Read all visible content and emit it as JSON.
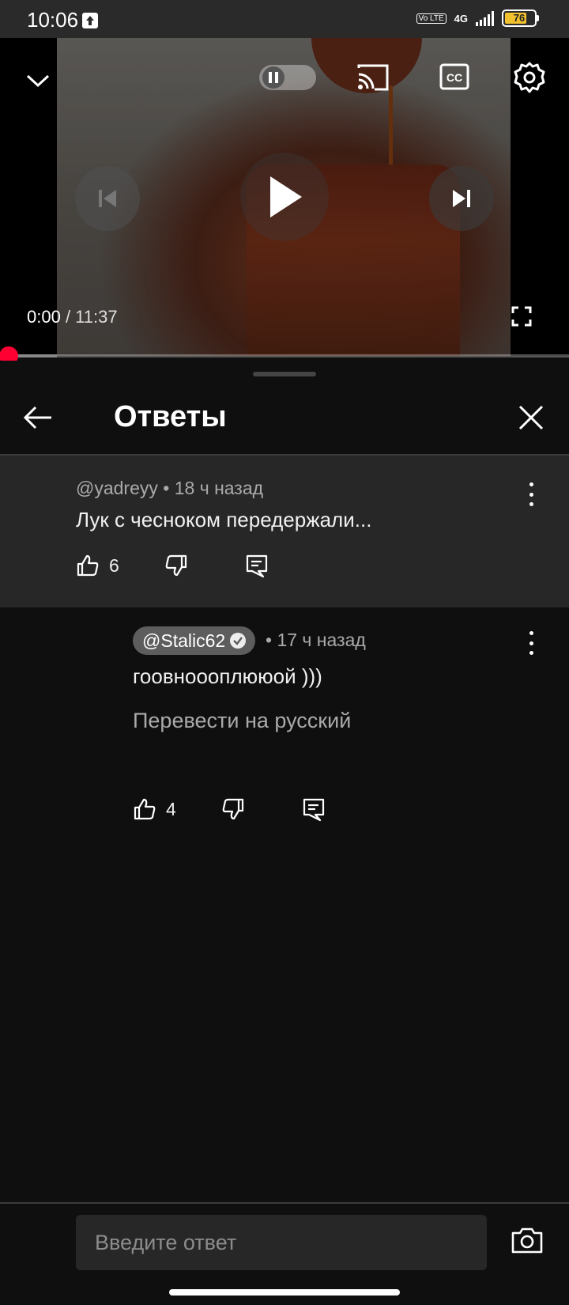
{
  "status_bar": {
    "time": "10:06",
    "volte": "Vo LTE",
    "network": "4G",
    "battery": "76",
    "battery_color": "#f2c12e"
  },
  "player": {
    "current_time": "0:00",
    "separator": " / ",
    "duration": "11:37",
    "progress_color": "#ff0033",
    "icons": [
      "chevron-down-icon",
      "pause-icon",
      "cast-icon",
      "captions-icon",
      "settings-icon",
      "previous-icon",
      "play-icon",
      "next-icon",
      "fullscreen-icon"
    ]
  },
  "panel": {
    "title": "Ответы"
  },
  "parent_comment": {
    "author": "@yadreyy",
    "time": "• 18 ч назад",
    "text": "Лук с чесноком передержали...",
    "likes": "6"
  },
  "reply": {
    "author": "@Stalic62",
    "time": "• 17 ч назад",
    "text": "гоовноооплююой )))",
    "translate_label": "Перевести на русский",
    "likes": "4"
  },
  "composer": {
    "placeholder": "Введите ответ"
  }
}
